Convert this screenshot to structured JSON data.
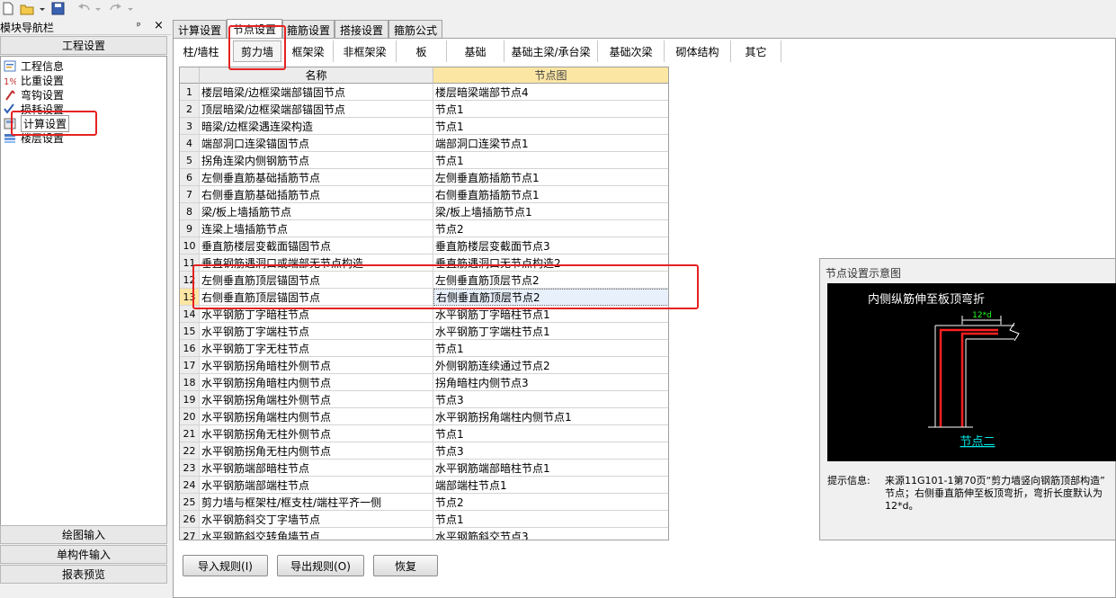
{
  "toolbar": {
    "icons": [
      "new-file-icon",
      "open-folder-icon",
      "save-icon",
      "undo-icon",
      "redo-icon"
    ]
  },
  "left_panel": {
    "title": "模块导航栏",
    "pin_glyph": "ᵖ",
    "close_glyph": "×",
    "section_top": "工程设置",
    "tree": [
      {
        "label": "工程信息",
        "icon": "info-icon"
      },
      {
        "label": "比重设置",
        "icon": "weight-icon"
      },
      {
        "label": "弯钩设置",
        "icon": "hook-icon"
      },
      {
        "label": "损耗设置",
        "icon": "loss-icon"
      },
      {
        "label": "计算设置",
        "icon": "calc-icon"
      },
      {
        "label": "楼层设置",
        "icon": "floor-icon"
      }
    ],
    "bottom_sections": [
      "绘图输入",
      "单构件输入",
      "报表预览"
    ]
  },
  "tabs": [
    "计算设置",
    "节点设置",
    "箍筋设置",
    "搭接设置",
    "箍筋公式"
  ],
  "active_tab": "节点设置",
  "subtabs": [
    "柱/墙柱",
    "剪力墙",
    "框架梁",
    "非框架梁",
    "板",
    "基础",
    "基础主梁/承台梁",
    "基础次梁",
    "砌体结构",
    "其它"
  ],
  "active_subtab": "剪力墙",
  "grid": {
    "headers": {
      "name": "名称",
      "node": "节点图"
    },
    "rows": [
      {
        "num": "1",
        "name": "楼层暗梁/边框梁端部锚固节点",
        "node": "楼层暗梁端部节点4"
      },
      {
        "num": "2",
        "name": "顶层暗梁/边框梁端部锚固节点",
        "node": "节点1"
      },
      {
        "num": "3",
        "name": "暗梁/边框梁遇连梁构造",
        "node": "节点1"
      },
      {
        "num": "4",
        "name": "端部洞口连梁锚固节点",
        "node": "端部洞口连梁节点1"
      },
      {
        "num": "5",
        "name": "拐角连梁内侧钢筋节点",
        "node": "节点1"
      },
      {
        "num": "6",
        "name": "左侧垂直筋基础插筋节点",
        "node": "左侧垂直筋插筋节点1"
      },
      {
        "num": "7",
        "name": "右侧垂直筋基础插筋节点",
        "node": "右侧垂直筋插筋节点1"
      },
      {
        "num": "8",
        "name": "梁/板上墙插筋节点",
        "node": "梁/板上墙插筋节点1"
      },
      {
        "num": "9",
        "name": "连梁上墙插筋节点",
        "node": "节点2"
      },
      {
        "num": "10",
        "name": "垂直筋楼层变截面锚固节点",
        "node": "垂直筋楼层变截面节点3"
      },
      {
        "num": "11",
        "name": "垂直钢筋遇洞口或端部无节点构造",
        "node": "垂直筋遇洞口无节点构造2"
      },
      {
        "num": "12",
        "name": "左侧垂直筋顶层锚固节点",
        "node": "左侧垂直筋顶层节点2"
      },
      {
        "num": "13",
        "name": "右侧垂直筋顶层锚固节点",
        "node": "右侧垂直筋顶层节点2"
      },
      {
        "num": "14",
        "name": "水平钢筋丁字暗柱节点",
        "node": "水平钢筋丁字暗柱节点1"
      },
      {
        "num": "15",
        "name": "水平钢筋丁字端柱节点",
        "node": "水平钢筋丁字端柱节点1"
      },
      {
        "num": "16",
        "name": "水平钢筋丁字无柱节点",
        "node": "节点1"
      },
      {
        "num": "17",
        "name": "水平钢筋拐角暗柱外侧节点",
        "node": "外侧钢筋连续通过节点2"
      },
      {
        "num": "18",
        "name": "水平钢筋拐角暗柱内侧节点",
        "node": "拐角暗柱内侧节点3"
      },
      {
        "num": "19",
        "name": "水平钢筋拐角端柱外侧节点",
        "node": "节点3"
      },
      {
        "num": "20",
        "name": "水平钢筋拐角端柱内侧节点",
        "node": "水平钢筋拐角端柱内侧节点1"
      },
      {
        "num": "21",
        "name": "水平钢筋拐角无柱外侧节点",
        "node": "节点1"
      },
      {
        "num": "22",
        "name": "水平钢筋拐角无柱内侧节点",
        "node": "节点3"
      },
      {
        "num": "23",
        "name": "水平钢筋端部暗柱节点",
        "node": "水平钢筋端部暗柱节点1"
      },
      {
        "num": "24",
        "name": "水平钢筋端部端柱节点",
        "node": "端部端柱节点1"
      },
      {
        "num": "25",
        "name": "剪力墙与框架柱/框支柱/端柱平齐一侧",
        "node": "节点2"
      },
      {
        "num": "26",
        "name": "水平钢筋斜交丁字墙节点",
        "node": "节点1"
      },
      {
        "num": "27",
        "name": "水平钢筋斜交转角墙节点",
        "node": "水平钢筋斜交节点3"
      }
    ],
    "selected_row": "13"
  },
  "buttons": {
    "import": "导入规则(I)",
    "export": "导出规则(O)",
    "restore": "恢复"
  },
  "preview": {
    "title": "节点设置示意图",
    "diagram_title": "内侧纵筋伸至板顶弯折",
    "dimension_label": "12*d",
    "diagram_caption": "节点二",
    "hint_label": "提示信息:",
    "hint_lines": [
      "来源11G101-1第70页“剪力墙竖向钢筋顶部构造”",
      "节点；右侧垂直筋伸至板顶弯折，弯折长度默认为",
      "12*d。"
    ]
  },
  "colors": {
    "annotation_red": "#e52222",
    "header_highlight": "#fce6a4",
    "rebar_red": "#ff2020",
    "caption_cyan": "#00e5e5",
    "dimension_green": "#20ff20"
  }
}
